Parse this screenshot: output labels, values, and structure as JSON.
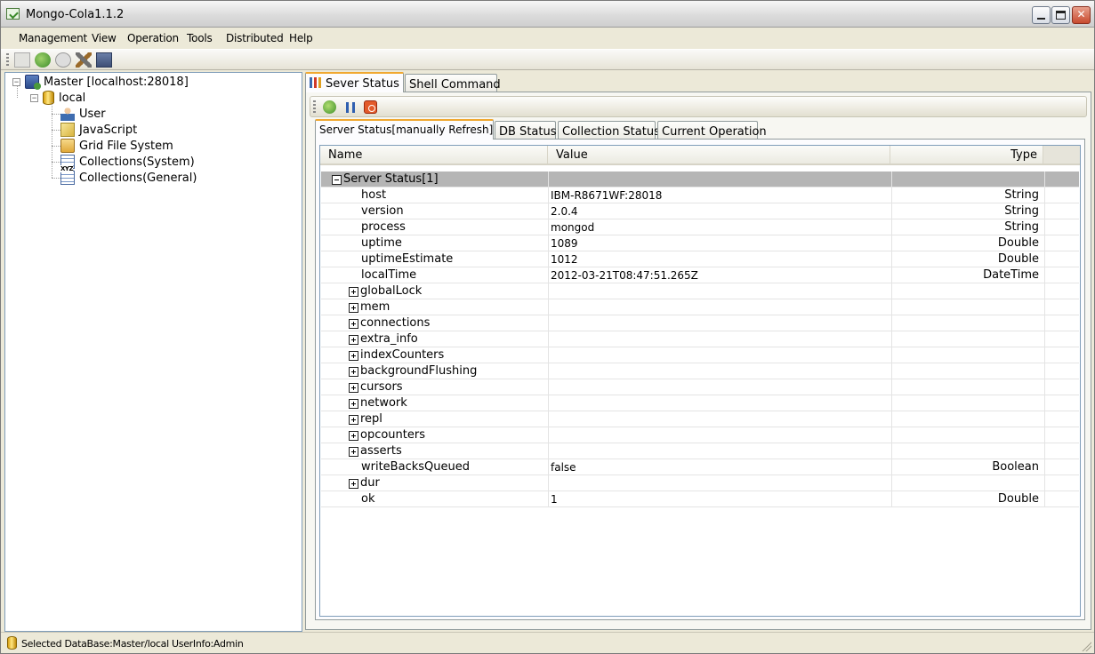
{
  "window": {
    "title": "Mongo-Cola1.1.2"
  },
  "menu": [
    "Management",
    "View",
    "Operation",
    "Tools",
    "Distributed",
    "Help"
  ],
  "toolbar": {
    "icons": [
      "document-icon",
      "connect-icon",
      "stop-icon",
      "tools-icon",
      "disk-icon"
    ]
  },
  "tree": {
    "root": "Master [localhost:28018]",
    "database": "local",
    "children": [
      "User",
      "JavaScript",
      "Grid File System",
      "Collections(System)",
      "Collections(General)"
    ]
  },
  "tabs": [
    "Sever Status",
    "Shell Command"
  ],
  "subtabs": [
    "Server Status[manually Refresh]",
    "DB Status",
    "Collection Status",
    "Current Operation"
  ],
  "grid": {
    "columns": {
      "name": "Name",
      "value": "Value",
      "type": "Type"
    },
    "group": "Server Status[1]",
    "rows": [
      {
        "name": "host",
        "value": "IBM-R8671WF:28018",
        "type": "String",
        "expandable": false
      },
      {
        "name": "version",
        "value": "2.0.4",
        "type": "String",
        "expandable": false
      },
      {
        "name": "process",
        "value": "mongod",
        "type": "String",
        "expandable": false
      },
      {
        "name": "uptime",
        "value": "1089",
        "type": "Double",
        "expandable": false
      },
      {
        "name": "uptimeEstimate",
        "value": "1012",
        "type": "Double",
        "expandable": false
      },
      {
        "name": "localTime",
        "value": "2012-03-21T08:47:51.265Z",
        "type": "DateTime",
        "expandable": false
      },
      {
        "name": "globalLock",
        "value": "",
        "type": "",
        "expandable": true
      },
      {
        "name": "mem",
        "value": "",
        "type": "",
        "expandable": true
      },
      {
        "name": "connections",
        "value": "",
        "type": "",
        "expandable": true
      },
      {
        "name": "extra_info",
        "value": "",
        "type": "",
        "expandable": true
      },
      {
        "name": "indexCounters",
        "value": "",
        "type": "",
        "expandable": true
      },
      {
        "name": "backgroundFlushing",
        "value": "",
        "type": "",
        "expandable": true
      },
      {
        "name": "cursors",
        "value": "",
        "type": "",
        "expandable": true
      },
      {
        "name": "network",
        "value": "",
        "type": "",
        "expandable": true
      },
      {
        "name": "repl",
        "value": "",
        "type": "",
        "expandable": true
      },
      {
        "name": "opcounters",
        "value": "",
        "type": "",
        "expandable": true
      },
      {
        "name": "asserts",
        "value": "",
        "type": "",
        "expandable": true
      },
      {
        "name": "writeBacksQueued",
        "value": "false",
        "type": "Boolean",
        "expandable": false
      },
      {
        "name": "dur",
        "value": "",
        "type": "",
        "expandable": true
      },
      {
        "name": "ok",
        "value": "1",
        "type": "Double",
        "expandable": false
      }
    ]
  },
  "status": {
    "text": "Selected DataBase:Master/local  UserInfo:Admin"
  },
  "colors": {
    "accent": "#f0a830",
    "group_row": "#b5b5b5",
    "border": "#7f9db9"
  }
}
